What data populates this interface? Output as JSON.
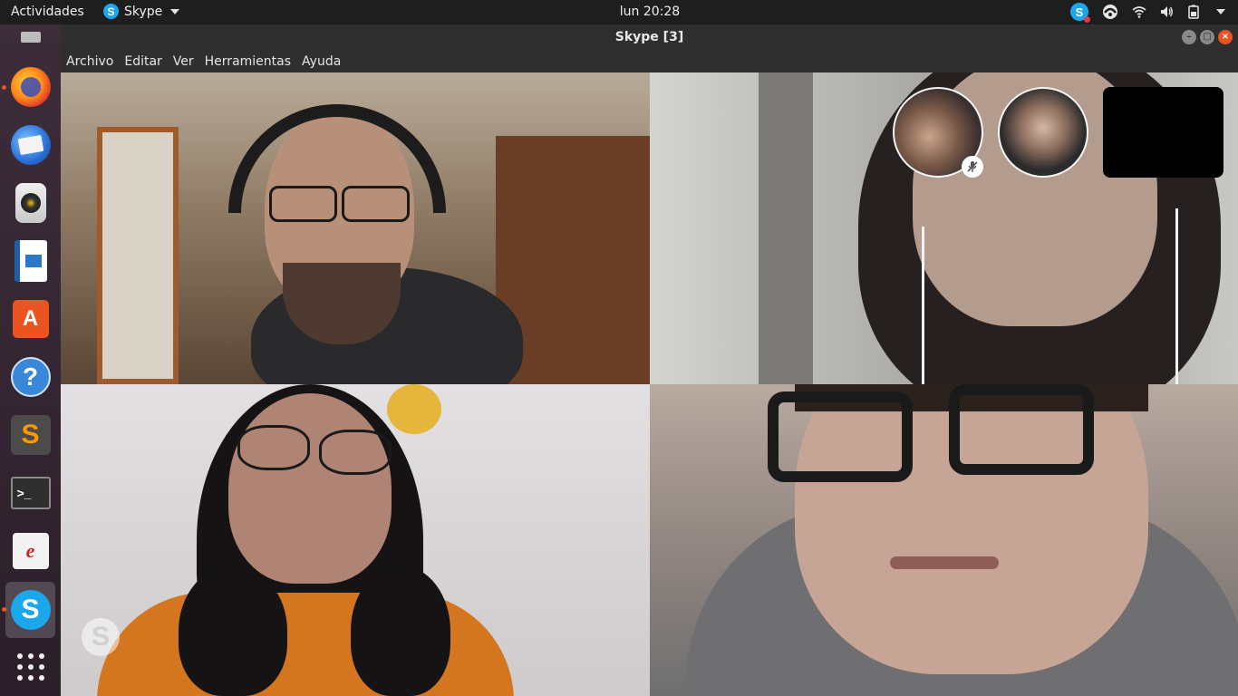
{
  "topbar": {
    "activities_label": "Actividades",
    "app_menu_label": "Skype",
    "clock": "lun 20:28",
    "tray": [
      "skype-icon",
      "network-status-icon",
      "wifi-icon",
      "volume-icon",
      "battery-icon",
      "chevron-down-icon"
    ]
  },
  "window": {
    "title": "Skype [3]",
    "controls": [
      "minimize",
      "maximize",
      "close"
    ]
  },
  "menu": {
    "items": [
      "Archivo",
      "Editar",
      "Ver",
      "Herramientas",
      "Ayuda"
    ]
  },
  "dock": {
    "items": [
      {
        "name": "firefox",
        "running": true
      },
      {
        "name": "thunderbird",
        "running": false
      },
      {
        "name": "rhythmbox",
        "running": false
      },
      {
        "name": "libreoffice-writer",
        "running": false
      },
      {
        "name": "ubuntu-software",
        "running": false
      },
      {
        "name": "help",
        "running": false
      },
      {
        "name": "sublime-text",
        "running": false
      },
      {
        "name": "terminal",
        "running": false
      },
      {
        "name": "evince",
        "running": false
      },
      {
        "name": "skype",
        "running": true,
        "active": true
      },
      {
        "name": "show-applications",
        "running": false
      }
    ]
  },
  "call": {
    "video_tiles": 4,
    "participant_thumbnails": 3,
    "muted_participant_thumbnail": 1
  },
  "colors": {
    "accent": "#e95420",
    "skype_blue": "#1aa7ec",
    "topbar_bg": "#1e1e1e",
    "window_chrome": "#2f2f2f"
  }
}
